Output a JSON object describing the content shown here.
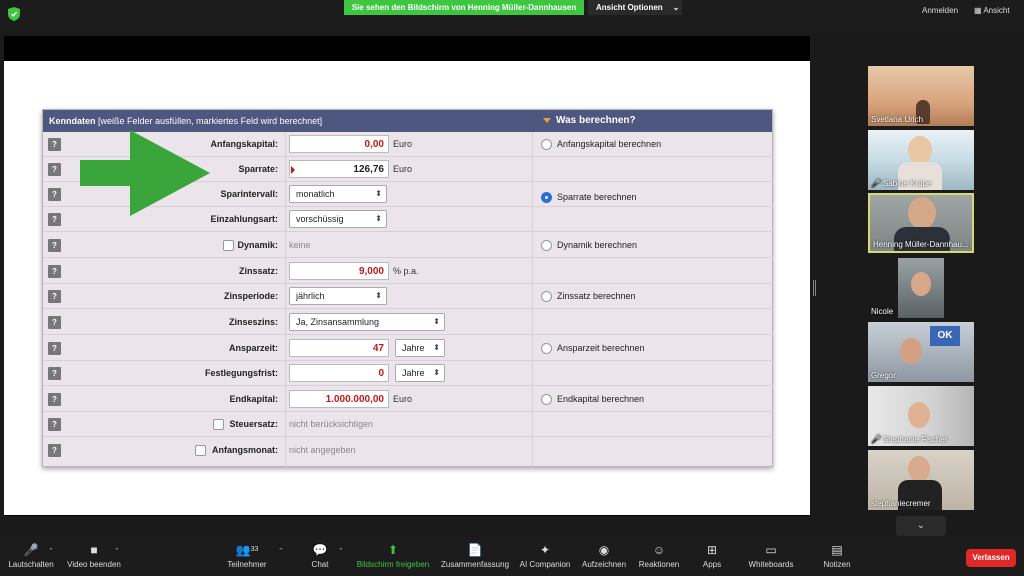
{
  "topbar": {
    "share_banner": "Sie sehen den Bildschirm von Henning Müller-Dannhausen",
    "view_options": "Ansicht Optionen",
    "sign_in": "Anmelden",
    "view": "Ansicht"
  },
  "calc": {
    "header_title": "Kenndaten",
    "header_hint": "[weiße Felder ausfüllen, markiertes Feld wird berechnet]",
    "header_right": "Was berechnen?",
    "help": "?",
    "rows": [
      {
        "label": "Anfangskapital:",
        "value": "0,00",
        "unit": "Euro"
      },
      {
        "label": "Sparrate:",
        "value": "126,76",
        "unit": "Euro"
      },
      {
        "label": "Sparintervall:",
        "select": "monatlich"
      },
      {
        "label": "Einzahlungsart:",
        "select": "vorschüssig"
      },
      {
        "label": "Dynamik:",
        "static": "keine"
      },
      {
        "label": "Zinssatz:",
        "value": "9,000",
        "unit": "% p.a."
      },
      {
        "label": "Zinsperiode:",
        "select": "jährlich"
      },
      {
        "label": "Zinseszins:",
        "select": "Ja, Zinsansammlung"
      },
      {
        "label": "Ansparzeit:",
        "value": "47",
        "select": "Jahre"
      },
      {
        "label": "Festlegungsfrist:",
        "value": "0",
        "select": "Jahre"
      },
      {
        "label": "Endkapital:",
        "value": "1.000.000,00",
        "unit": "Euro"
      },
      {
        "label": "Steuersatz:",
        "static": "nicht berücksichtigen"
      },
      {
        "label": "Anfangsmonat:",
        "static": "nicht angegeben"
      }
    ],
    "radios": [
      "Anfangskapital berechnen",
      "Sparrate berechnen",
      "Dynamik berechnen",
      "Zinssatz berechnen",
      "Ansparzeit berechnen",
      "Endkapital berechnen"
    ],
    "selected_radio": "Sparrate berechnen"
  },
  "participants": [
    {
      "name": "Svetlana Urich",
      "muted": false
    },
    {
      "name": "Sabine Krüpe",
      "muted": true
    },
    {
      "name": "Henning Müller-Dannhau...",
      "muted": false
    },
    {
      "name": "Nicole",
      "muted": false
    },
    {
      "name": "Gregor",
      "muted": false
    },
    {
      "name": "Stephanie Fischer",
      "muted": true
    },
    {
      "name": "stephaniecremer",
      "muted": false
    }
  ],
  "toolbar": {
    "mute": "Lautschalten",
    "video": "Video beenden",
    "participants": "Teilnehmer",
    "participants_count": "33",
    "chat": "Chat",
    "share": "Bildschirm freigeben",
    "summary": "Zusammenfassung",
    "ai": "AI Companion",
    "record": "Aufzeichnen",
    "reactions": "Reaktionen",
    "apps": "Apps",
    "whiteboards": "Whiteboards",
    "notes": "Notizen",
    "leave": "Verlassen"
  },
  "colors": {
    "share_green": "#3ec640",
    "header_blue": "#4d5780",
    "value_red": "#c01818",
    "leave_red": "#e02828",
    "arrow_green": "#3aa53a"
  }
}
